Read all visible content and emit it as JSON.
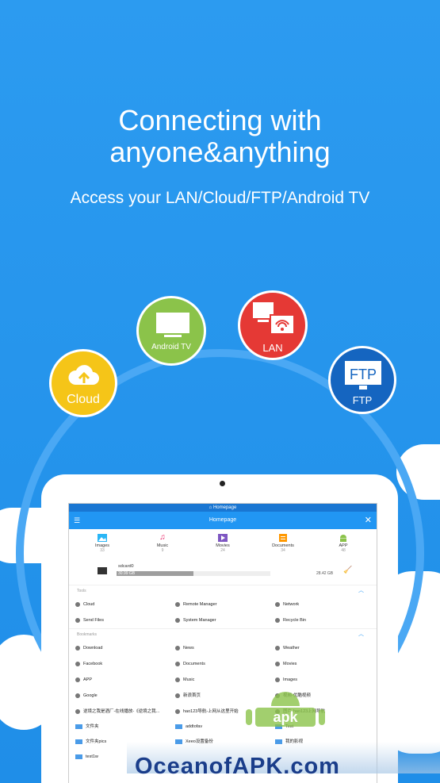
{
  "headline": {
    "line1": "Connecting with",
    "line2": "anyone&anything"
  },
  "subheadline": "Access your LAN/Cloud/FTP/Android TV",
  "bubbles": [
    {
      "label": "Cloud",
      "color": "#f5c518",
      "icon": "cloud-upload-icon"
    },
    {
      "label": "Android TV",
      "color": "#8bc34a",
      "icon": "tv-icon"
    },
    {
      "label": "LAN",
      "color": "#e53935",
      "icon": "lan-icon"
    },
    {
      "label": "FTP",
      "color": "#1565c0",
      "icon": "ftp-monitor-icon"
    }
  ],
  "app": {
    "status_title": "Homepage",
    "appbar_title": "Homepage",
    "categories": [
      {
        "label": "Images",
        "count": "33",
        "icon": "image-icon",
        "color": "#29b6f6"
      },
      {
        "label": "Music",
        "count": "9",
        "icon": "music-icon",
        "color": "#e91e63"
      },
      {
        "label": "Movies",
        "count": "24",
        "icon": "movie-icon",
        "color": "#7e57c2"
      },
      {
        "label": "Documents",
        "count": "34",
        "icon": "document-icon",
        "color": "#ff9800"
      },
      {
        "label": "APP",
        "count": "48",
        "icon": "android-icon",
        "color": "#8bc34a"
      }
    ],
    "storage": {
      "name": "sdcard0",
      "used_label": "30.99 GB",
      "total_label": "28.42 GB",
      "used_fraction": 0.5
    },
    "tools_header": "Tools",
    "tools": [
      "Cloud",
      "Remote Manager",
      "Network",
      "Send Files",
      "System Manager",
      "Recycle Bin"
    ],
    "bookmarks_header": "Bookmarks",
    "bookmarks": [
      "Download",
      "News",
      "Weather",
      "Facebook",
      "Documents",
      "Movies",
      "APP",
      "Music",
      "Images",
      "Google",
      "新浪首页",
      "视频-优酷视频",
      "逆境之我是酒厂-在线播放-《逆境之我...",
      "hao123导航-上网从这里开始",
      "图片-hao123上网导航"
    ],
    "folders": [
      "文件夹",
      "addtofav",
      "Test",
      "文件夹pics",
      "Xeeo设置备份",
      "我的影视",
      "test1w"
    ]
  },
  "watermark": "OceanofAPK.com",
  "apk_badge": "apk"
}
